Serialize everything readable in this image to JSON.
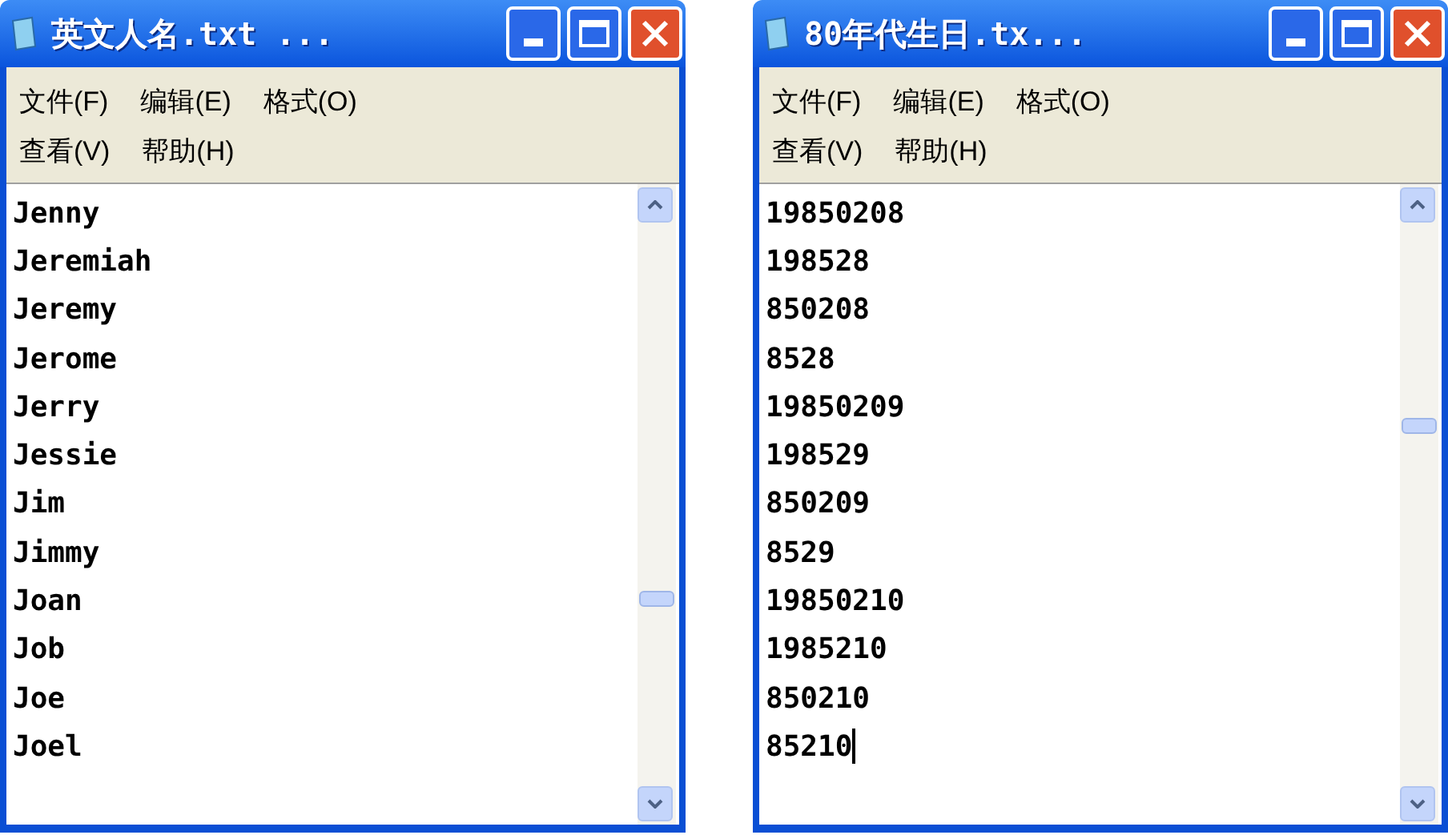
{
  "windows": [
    {
      "title": "英文人名.txt ...",
      "menu_rows": [
        [
          "文件(F)",
          "编辑(E)",
          "格式(O)"
        ],
        [
          "查看(V)",
          "帮助(H)"
        ]
      ],
      "lines": [
        "Jenny",
        "Jeremiah",
        "Jeremy",
        "Jerome",
        "Jerry",
        "Jessie",
        "Jim",
        "Jimmy",
        "Joan",
        "Job",
        "Joe",
        "Joel"
      ],
      "caret_at_end": false
    },
    {
      "title": "80年代生日.tx...",
      "menu_rows": [
        [
          "文件(F)",
          "编辑(E)",
          "格式(O)"
        ],
        [
          "查看(V)",
          "帮助(H)"
        ]
      ],
      "lines": [
        "19850208",
        "198528",
        "850208",
        "8528",
        "19850209",
        "198529",
        "850209",
        "8529",
        "19850210",
        "1985210",
        "850210",
        "85210"
      ],
      "caret_at_end": true
    }
  ]
}
